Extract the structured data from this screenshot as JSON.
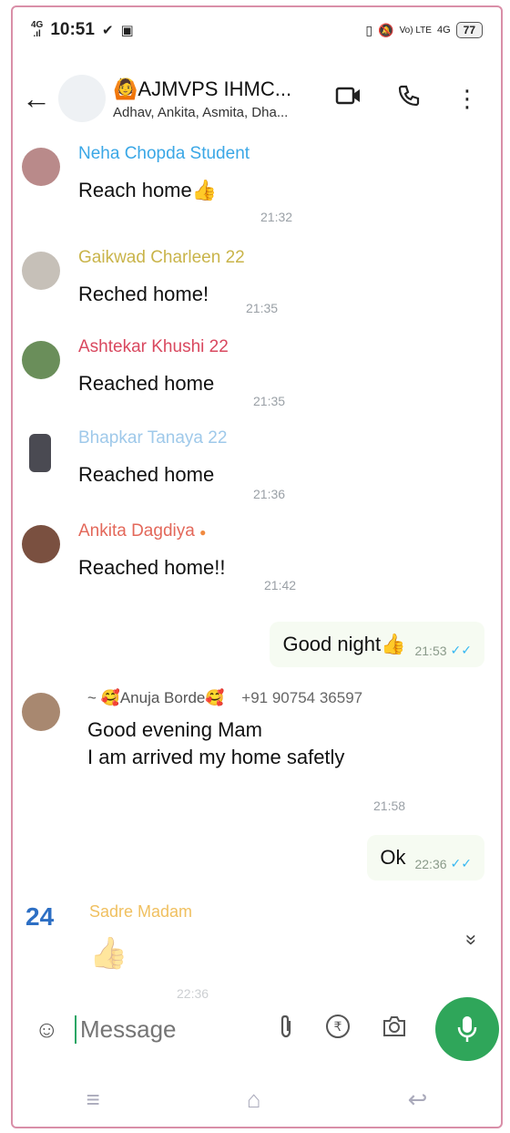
{
  "status": {
    "network": "4G",
    "time": "10:51",
    "volte": "Vo) LTE",
    "net2": "4G",
    "battery": "77"
  },
  "header": {
    "title": "🙆AJMVPS IHMC...",
    "subtitle": "Adhav, Ankita, Asmita, Dha..."
  },
  "messages": [
    {
      "sender": "Neha Chopda Student",
      "sender_color": "#3aa7e6",
      "text": "Reach home👍",
      "time": "21:32"
    },
    {
      "sender": "Gaikwad Charleen 22",
      "sender_color": "#c9b44a",
      "text": "Reched home!",
      "time": "21:35"
    },
    {
      "sender": "Ashtekar Khushi 22",
      "sender_color": "#d9485f",
      "text": "Reached home",
      "time": "21:35"
    },
    {
      "sender": "Bhapkar Tanaya 22",
      "sender_color": "#9fc9ea",
      "text": "Reached home",
      "time": "21:36"
    },
    {
      "sender": "Ankita Dagdiya",
      "sender_color": "#e3685a",
      "text": "Reached home!!",
      "time": "21:42"
    },
    {
      "sender": "~ 🥰Anuja Borde🥰",
      "sender_color": "#555555",
      "phone": "+91 90754 36597",
      "text1": "Good evening Mam",
      "text2": "I am arrived my home safetly",
      "time": "21:58"
    },
    {
      "sender": "Sadre Madam",
      "sender_color": "#f0c060",
      "text": "👍",
      "time": "22:36"
    }
  ],
  "outgoing": [
    {
      "text": "Good night👍",
      "time": "21:53",
      "ticks": "✓✓"
    },
    {
      "text": "Ok",
      "time": "22:36",
      "ticks": "✓✓"
    }
  ],
  "unread_count": "24",
  "input": {
    "placeholder": "Message"
  },
  "icons": {
    "back": "←",
    "video": "▭",
    "call": "✆",
    "menu": "⋮",
    "emoji": "☺",
    "attach": "📎",
    "rupee": "₹",
    "camera": "📷",
    "mic": "🎤",
    "scroll": "»",
    "nav_menu": "≡",
    "nav_home": "⌂",
    "nav_back": "↩"
  }
}
